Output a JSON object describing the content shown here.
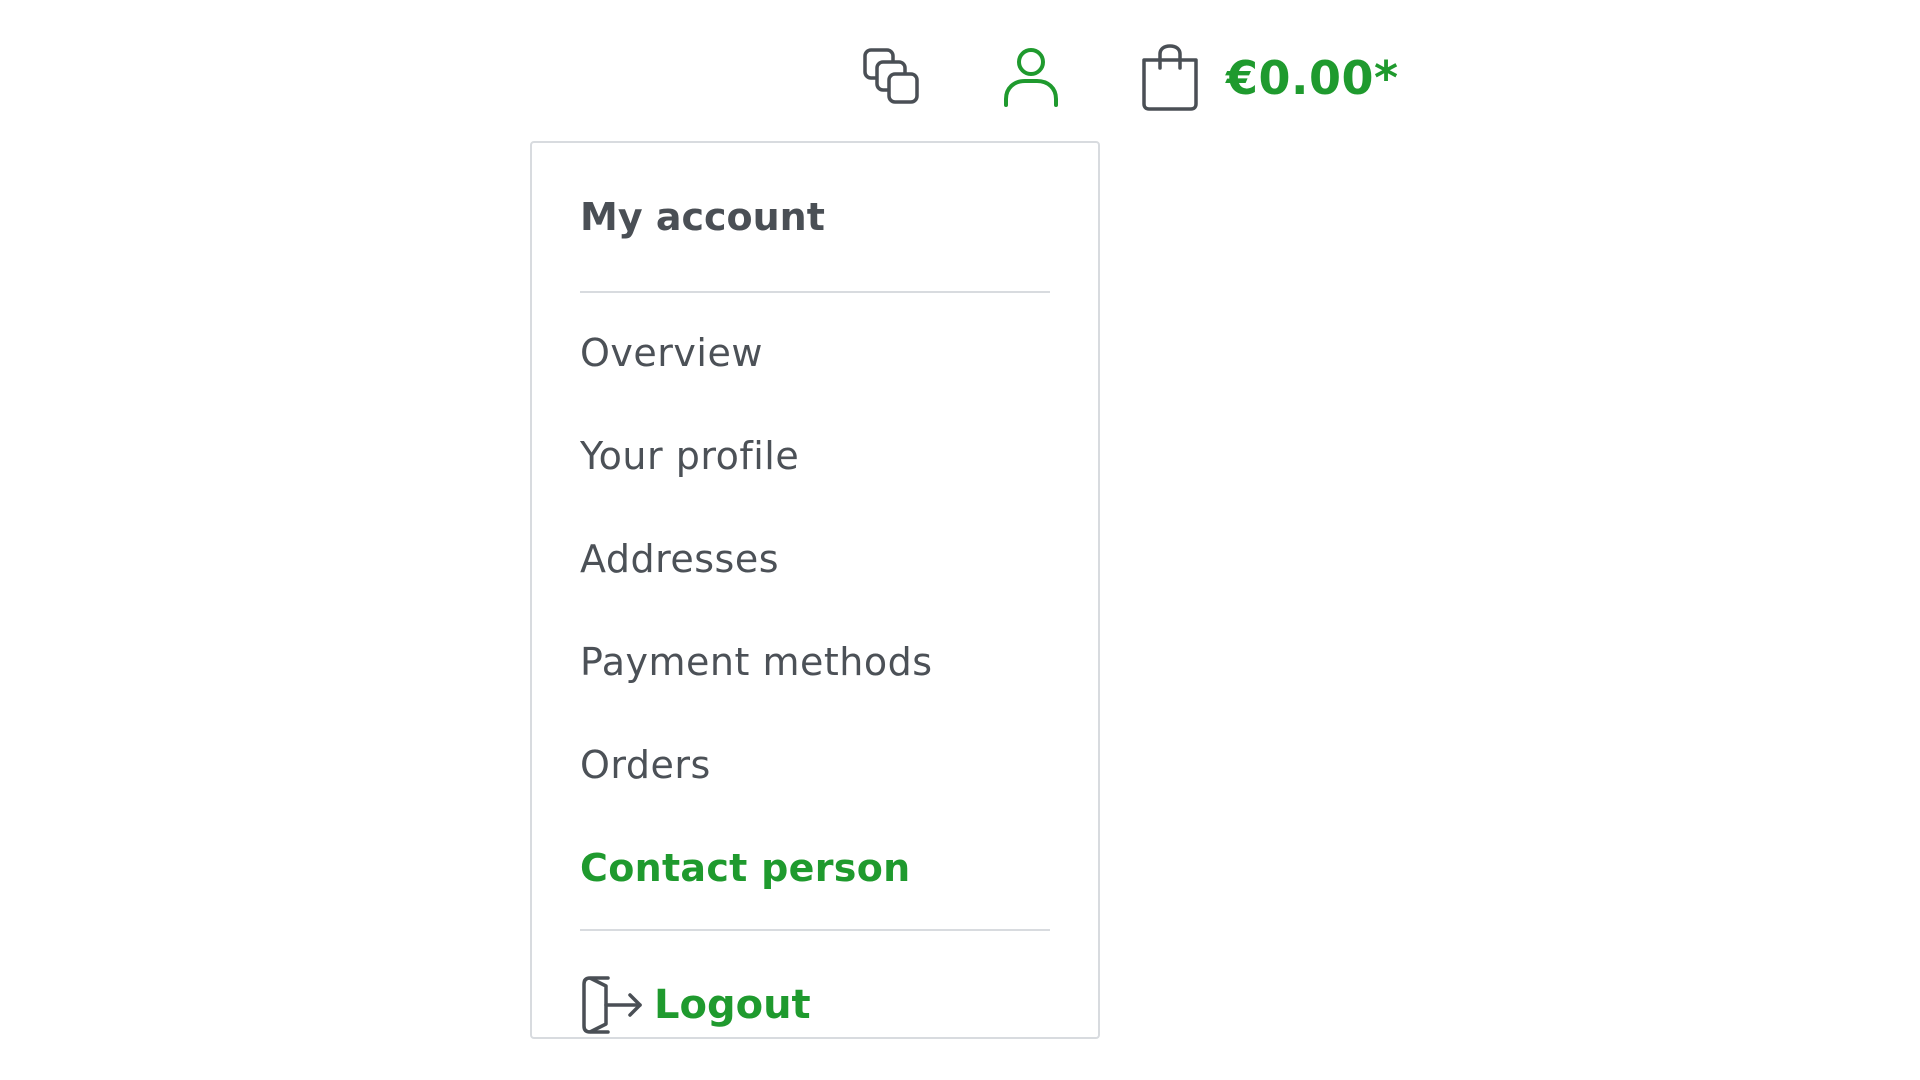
{
  "header": {
    "compare_icon": "compare-icon",
    "account_icon": "user-icon",
    "cart_icon": "shopping-bag-icon",
    "cart_total": "€0.00*"
  },
  "account_menu": {
    "title": "My account",
    "items": [
      {
        "label": "Overview",
        "active": false
      },
      {
        "label": "Your profile",
        "active": false
      },
      {
        "label": "Addresses",
        "active": false
      },
      {
        "label": "Payment methods",
        "active": false
      },
      {
        "label": "Orders",
        "active": false
      },
      {
        "label": "Contact person",
        "active": true
      }
    ],
    "logout_label": "Logout",
    "logout_icon": "logout-icon"
  },
  "colors": {
    "accent": "#1f9a2e",
    "icon_gray": "#4a4f55",
    "text": "#4c5157",
    "border": "#d8dbdf"
  }
}
